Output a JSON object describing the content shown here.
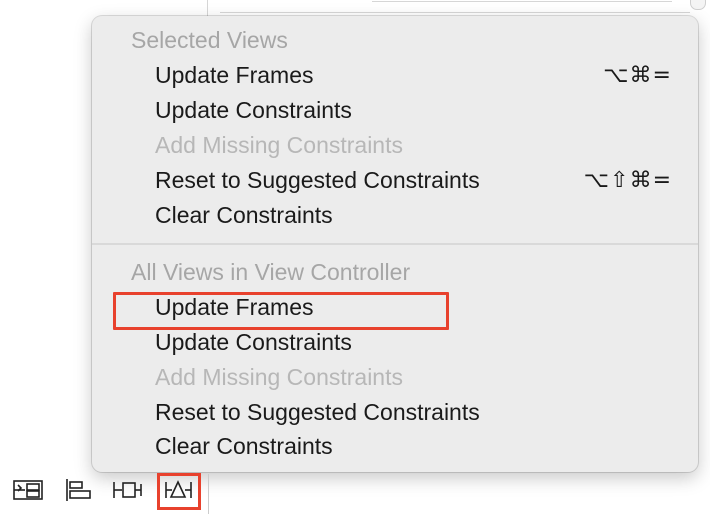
{
  "menu": {
    "selected_views": {
      "header": "Selected Views",
      "items": [
        {
          "label": "Update Frames",
          "shortcut": "⌥⌘=",
          "enabled": true
        },
        {
          "label": "Update Constraints",
          "shortcut": "",
          "enabled": true
        },
        {
          "label": "Add Missing Constraints",
          "shortcut": "",
          "enabled": false
        },
        {
          "label": "Reset to Suggested Constraints",
          "shortcut": "⌥⇧⌘=",
          "enabled": true
        },
        {
          "label": "Clear Constraints",
          "shortcut": "",
          "enabled": true
        }
      ]
    },
    "all_views": {
      "header": "All Views in View Controller",
      "items": [
        {
          "label": "Update Frames",
          "enabled": true,
          "annotated": true
        },
        {
          "label": "Update Constraints",
          "enabled": true
        },
        {
          "label": "Add Missing Constraints",
          "enabled": false
        },
        {
          "label": "Reset to Suggested Constraints",
          "enabled": true
        },
        {
          "label": "Clear Constraints",
          "enabled": true
        }
      ]
    }
  },
  "toolbar": {
    "icons": [
      "embed-in-stack-icon",
      "align-icon",
      "pin-icon",
      "resolve-auto-layout-issues-icon"
    ],
    "active_icon": "resolve-auto-layout-issues-icon"
  },
  "colors": {
    "annotation": "#e8412d",
    "menu_background": "#ececec",
    "header_text": "#a6a6a6",
    "disabled_text": "#b7b7b7",
    "enabled_text": "#1a1a1a"
  }
}
